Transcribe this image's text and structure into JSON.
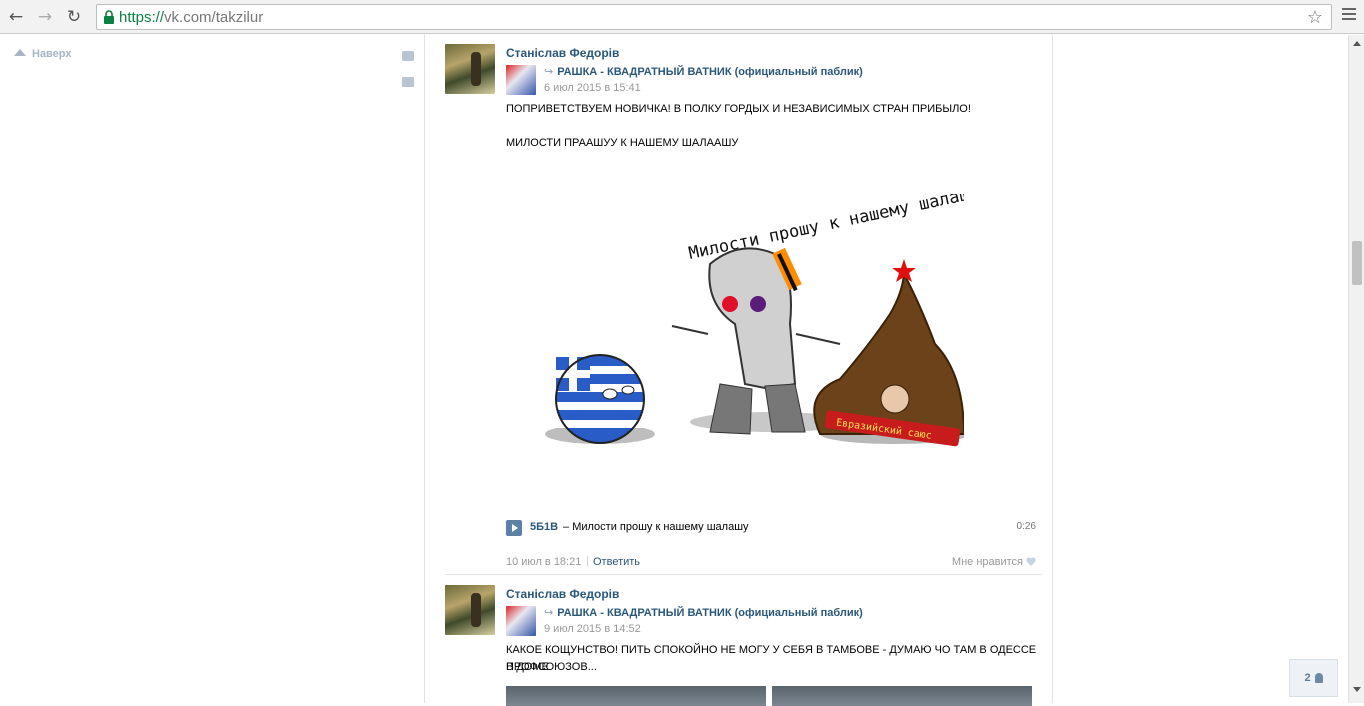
{
  "browser": {
    "url_scheme": "https://",
    "url_rest": "vk.com/takzilur"
  },
  "left": {
    "up_label": "Наверх"
  },
  "posts": [
    {
      "author": "Станіслав Федорів",
      "source": "РАШКА - КВАДРАТНЫЙ ВАТНИК (официальный паблик)",
      "date": "6 июл 2015 в 15:41",
      "text_line1": "ПОПРИВЕТСТВУЕМ НОВИЧКА! В ПОЛКУ ГОРДЫХ И НЕЗАВИСИМЫХ СТРАН ПРИБЫЛО!",
      "text_line2": "МИЛОСТИ ПРААШУУ К НАШЕМУ ШАЛААШУ",
      "image_caption": "Милости прошу к нашему шалашу",
      "image_banner": "Евразийский саюс",
      "audio": {
        "artist": "5Б1В",
        "dash": "–",
        "title": "Милости прошу к нашему шалашу",
        "duration": "0:26"
      },
      "footer": {
        "date": "10 июл в 18:21",
        "separator": "|",
        "reply": "Ответить",
        "like": "Мне нравится"
      }
    },
    {
      "author": "Станіслав Федорів",
      "source": "РАШКА - КВАДРАТНЫЙ ВАТНИК (официальный паблик)",
      "date": "9 июл 2015 в 14:52",
      "text_line1": "КАКОЕ КОЩУНСТВО! ПИТЬ СПОКОЙНО НЕ МОГУ У СЕБЯ В ТАМБОВЕ - ДУМАЮ ЧО ТАМ В ОДЕССЕ В ДОМЕ",
      "text_line2": "ПРОФСОЮЗОВ..."
    }
  ],
  "friends_online": "2",
  "colors": {
    "link": "#2b587a",
    "muted": "#999999",
    "border": "#dfe3e8"
  }
}
